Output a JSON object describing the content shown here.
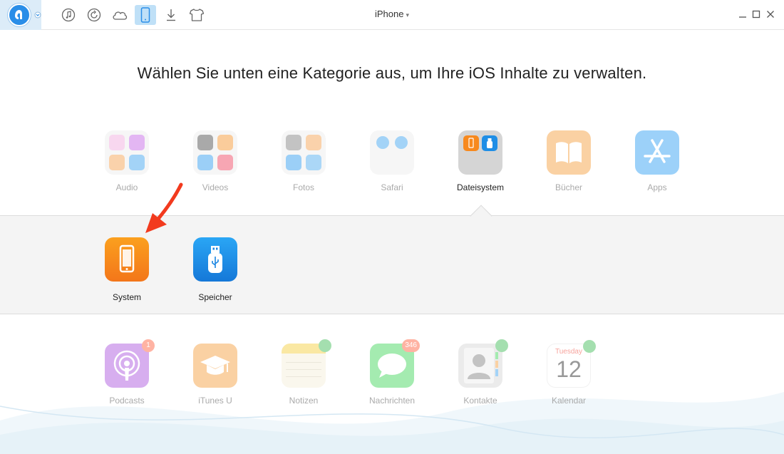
{
  "window": {
    "device_name": "iPhone"
  },
  "heading": "Wählen Sie unten eine Kategorie aus, um Ihre iOS Inhalte zu verwalten.",
  "categories_row1": [
    {
      "label": "Audio"
    },
    {
      "label": "Videos"
    },
    {
      "label": "Fotos"
    },
    {
      "label": "Safari"
    },
    {
      "label": "Dateisystem"
    },
    {
      "label": "Bücher"
    },
    {
      "label": "Apps"
    }
  ],
  "subpanel": [
    {
      "label": "System"
    },
    {
      "label": "Speicher"
    }
  ],
  "categories_row2": [
    {
      "label": "Podcasts",
      "badge": "1"
    },
    {
      "label": "iTunes U"
    },
    {
      "label": "Notizen"
    },
    {
      "label": "Nachrichten",
      "badge": "346"
    },
    {
      "label": "Kontakte"
    },
    {
      "label": "Kalendar",
      "calendar_day": "Tuesday",
      "calendar_date": "12"
    }
  ],
  "colors": {
    "accent": "#2a8ee8",
    "system_orange": "#f7931e",
    "speicher_blue": "#1f8ee6",
    "badge_red": "#ff6a4a",
    "cloud_green": "#4cc061",
    "arrow_red": "#f23a1e"
  },
  "icons": {
    "toolbar": [
      "music-note-icon",
      "restore-icon",
      "cloud-icon",
      "phone-icon",
      "download-icon",
      "tshirt-icon"
    ]
  }
}
